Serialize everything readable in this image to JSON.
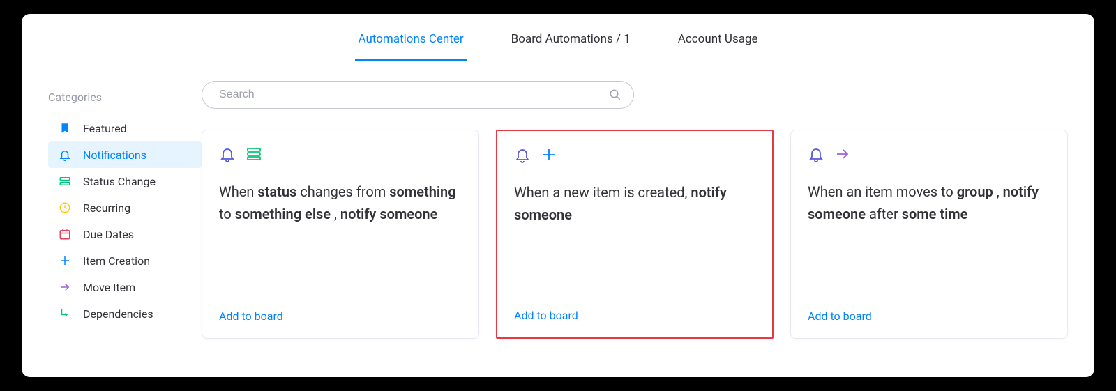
{
  "tabs": {
    "center": "Automations Center",
    "board": "Board Automations / 1",
    "usage": "Account Usage"
  },
  "sidebar": {
    "title": "Categories",
    "items": [
      {
        "label": "Featured"
      },
      {
        "label": "Notifications"
      },
      {
        "label": "Status Change"
      },
      {
        "label": "Recurring"
      },
      {
        "label": "Due Dates"
      },
      {
        "label": "Item Creation"
      },
      {
        "label": "Move Item"
      },
      {
        "label": "Dependencies"
      }
    ]
  },
  "search": {
    "placeholder": "Search"
  },
  "cards": {
    "add_label": "Add to board",
    "c0": {
      "t0": "When ",
      "t1": "status",
      "t2": " changes from ",
      "t3": "something",
      "t4": " to ",
      "t5": "something else",
      "t6": " , ",
      "t7": "notify",
      "t8": " ",
      "t9": "someone"
    },
    "c1": {
      "t0": "When a new item is created, ",
      "t1": "notify",
      "t2": " ",
      "t3": "someone"
    },
    "c2": {
      "t0": "When an item moves to ",
      "t1": "group",
      "t2": " , ",
      "t3": "notify",
      "t4": " ",
      "t5": "someone",
      "t6": " after ",
      "t7": "some time"
    }
  }
}
